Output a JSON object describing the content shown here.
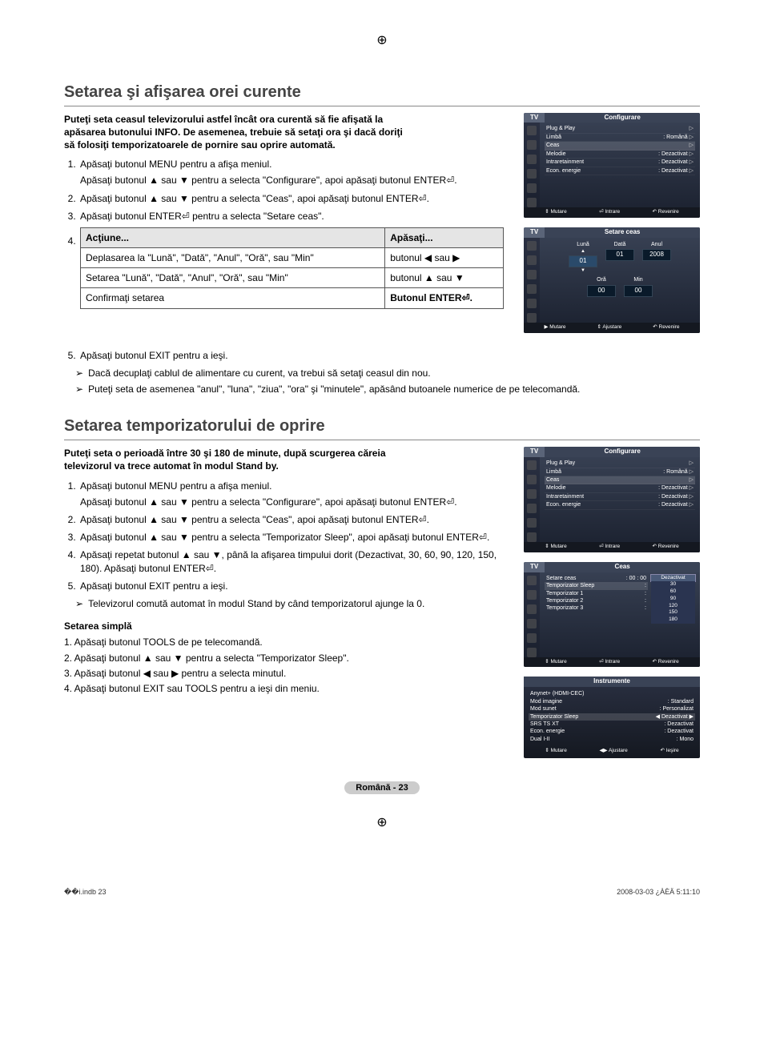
{
  "page": {
    "lang_page": "Română - 23",
    "footer_left": "��i.indb   23",
    "footer_right": "2008-03-03   ¿ÀÈÄ 5:11:10"
  },
  "section1": {
    "title": "Setarea şi afişarea orei curente",
    "intro": "Puteţi seta ceasul televizorului astfel încât ora curentă să fie afişată la apăsarea butonului INFO. De asemenea, trebuie să setaţi ora şi dacă doriţi să folosiţi temporizatoarele de pornire sau oprire automată.",
    "step1a": "Apăsaţi butonul MENU pentru a afişa meniul.",
    "step1b": "Apăsaţi butonul ▲ sau ▼ pentru a selecta \"Configurare\", apoi apăsaţi butonul ENTER⏎.",
    "step2": "Apăsaţi butonul ▲ sau ▼ pentru a selecta \"Ceas\", apoi apăsaţi butonul ENTER⏎.",
    "step3": "Apăsaţi butonul ENTER⏎ pentru a selecta \"Setare ceas\".",
    "step4_label": "4.",
    "table": {
      "h1": "Acţiune...",
      "h2": "Apăsaţi...",
      "r1c1": "Deplasarea la \"Lună\", \"Dată\", \"Anul\", \"Oră\", sau \"Min\"",
      "r1c2": "butonul ◀ sau ▶",
      "r2c1": "Setarea \"Lună\", \"Dată\", \"Anul\", \"Oră\", sau \"Min\"",
      "r2c2": "butonul ▲ sau ▼",
      "r3c1": "Confirmaţi setarea",
      "r3c2": "Butonul ENTER⏎."
    },
    "step5": "Apăsaţi butonul EXIT pentru a ieşi.",
    "note1": "Dacă decuplaţi cablul de alimentare cu curent, va trebui să setaţi ceasul din nou.",
    "note2": "Puteţi seta de asemenea \"anul\", \"luna\", \"ziua\", \"ora\" şi \"minutele\", apăsând butoanele numerice de pe telecomandă."
  },
  "section2": {
    "title": "Setarea temporizatorului de oprire",
    "intro": "Puteţi seta o perioadă între 30 şi 180 de minute, după scurgerea căreia televizorul va trece automat în modul Stand by.",
    "step1a": "Apăsaţi butonul MENU pentru a afişa meniul.",
    "step1b": "Apăsaţi butonul ▲ sau ▼ pentru a selecta \"Configurare\", apoi apăsaţi butonul ENTER⏎.",
    "step2": "Apăsaţi butonul ▲ sau ▼ pentru a selecta \"Ceas\", apoi apăsaţi butonul ENTER⏎.",
    "step3": "Apăsaţi butonul ▲ sau ▼ pentru a selecta \"Temporizator Sleep\", apoi apăsaţi butonul ENTER⏎.",
    "step4": "Apăsaţi repetat butonul ▲ sau ▼, până la afişarea timpului dorit (Dezactivat, 30, 60, 90, 120, 150, 180). Apăsaţi butonul ENTER⏎.",
    "step5": "Apăsaţi butonul EXIT pentru a ieşi.",
    "note1": "Televizorul comută automat în modul Stand by când temporizatorul ajunge la 0.",
    "simple_title": "Setarea simplă",
    "simple1": "1. Apăsaţi butonul TOOLS de pe telecomandă.",
    "simple2": "2. Apăsaţi butonul ▲ sau ▼ pentru a selecta \"Temporizator Sleep\".",
    "simple3": "3. Apăsaţi butonul ◀ sau ▶ pentru a selecta minutul.",
    "simple4": "4. Apăsaţi butonul EXIT sau TOOLS pentru a ieşi din meniu."
  },
  "osd": {
    "tv_tab": "TV",
    "config_title": "Configurare",
    "clock_set_title": "Setare ceas",
    "ceas_title": "Ceas",
    "instr_title": "Instrumente",
    "footer_move": "Mutare",
    "footer_enter": "Intrare",
    "footer_return": "Revenire",
    "footer_adjust": "Ajustare",
    "footer_exit": "Ieşire",
    "config_items": {
      "plug": "Plug & Play",
      "limba": "Limbă",
      "limba_v": ": Română",
      "ceas": "Ceas",
      "melodie": "Melodie",
      "mel_v": ": Dezactivat",
      "intra": "Intraretainment",
      "intra_v": ": Dezactivat",
      "econ": "Econ. energie",
      "econ_v": ": Dezactivat"
    },
    "clock": {
      "luna": "Lună",
      "data": "Dată",
      "anul": "Anul",
      "luna_v": "01",
      "data_v": "01",
      "anul_v": "2008",
      "ora": "Oră",
      "min": "Min",
      "ora_v": "00",
      "min_v": "00"
    },
    "ceas_menu": {
      "setare": "Setare ceas",
      "setare_v": ": 00 : 00",
      "sleep": "Temporizator Sleep",
      "t1": "Temporizator 1",
      "t1_v": ":",
      "t2": "Temporizator 2",
      "t2_v": ":",
      "t3": "Temporizator 3",
      "t3_v": ":",
      "opts": [
        "Dezactivat",
        "30",
        "60",
        "90",
        "120",
        "150",
        "180"
      ]
    },
    "instr": {
      "anynet": "Anynet+ (HDMI-CEC)",
      "img": "Mod imagine",
      "img_v": ": Standard",
      "snd": "Mod sunet",
      "snd_v": ": Personalizat",
      "sleep": "Temporizator Sleep",
      "sleep_v": "◀ Dezactivat ▶",
      "srs": "SRS TS XT",
      "srs_v": ": Dezactivat",
      "econ": "Econ. energie",
      "econ_v": ": Dezactivat",
      "dual": "Dual I-II",
      "dual_v": ": Mono"
    }
  }
}
